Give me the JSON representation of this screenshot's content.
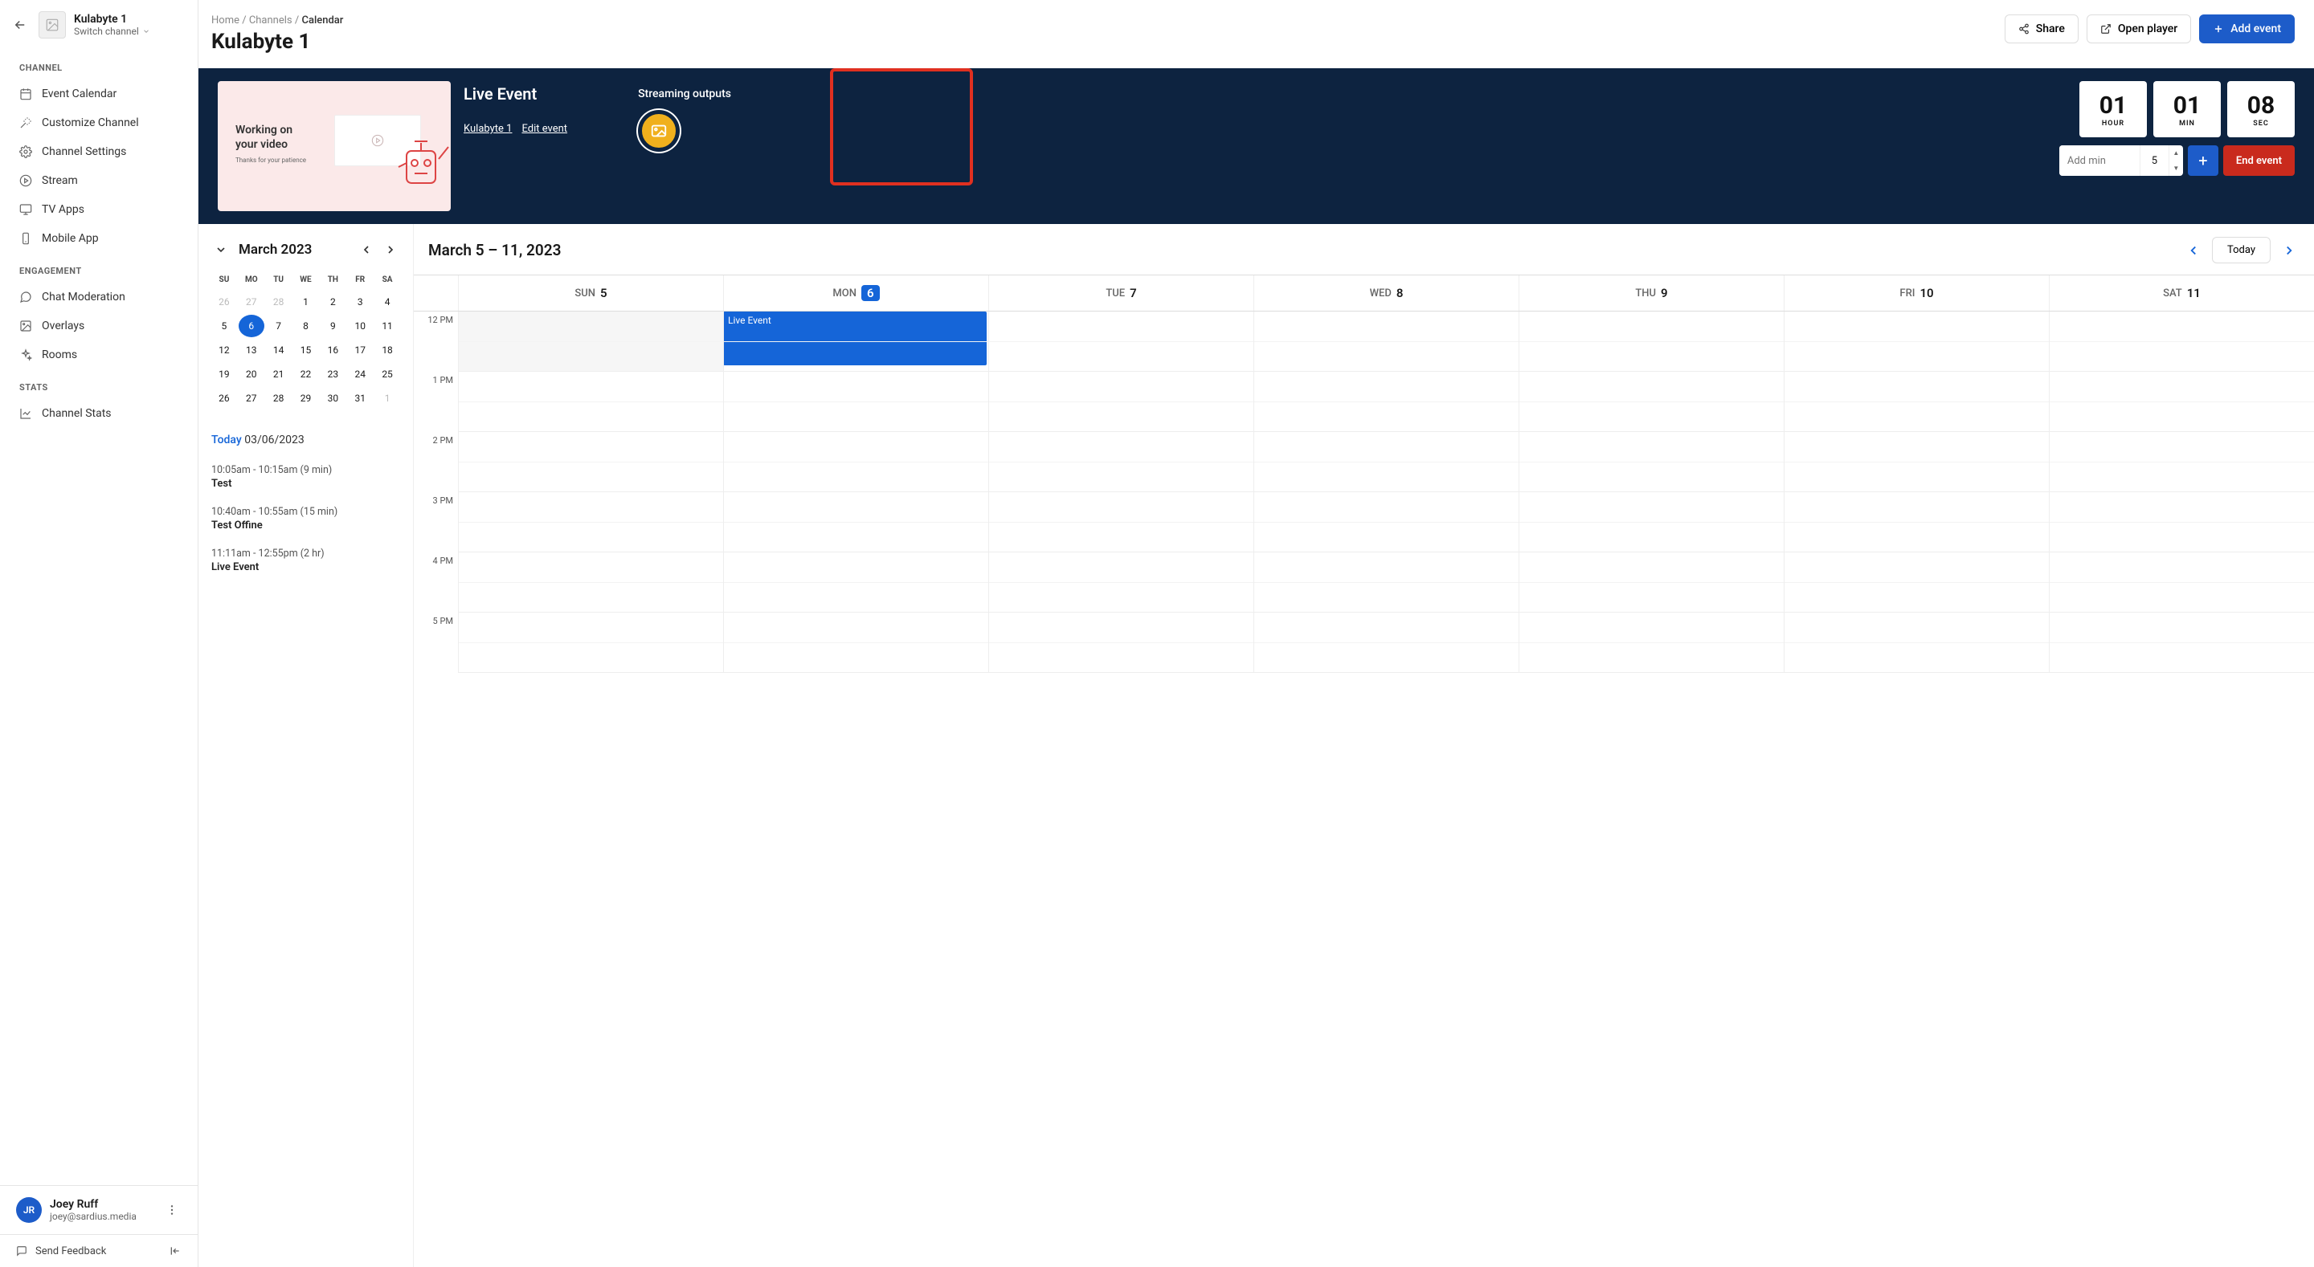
{
  "sidebar": {
    "channel_name": "Kulabyte 1",
    "switch_label": "Switch channel",
    "sections": {
      "channel": {
        "label": "CHANNEL",
        "items": [
          "Event Calendar",
          "Customize Channel",
          "Channel Settings",
          "Stream",
          "TV Apps",
          "Mobile App"
        ]
      },
      "engagement": {
        "label": "ENGAGEMENT",
        "items": [
          "Chat Moderation",
          "Overlays",
          "Rooms"
        ]
      },
      "stats": {
        "label": "STATS",
        "items": [
          "Channel Stats"
        ]
      }
    },
    "user": {
      "initials": "JR",
      "name": "Joey Ruff",
      "email": "joey@sardius.media"
    },
    "feedback": "Send Feedback"
  },
  "breadcrumb": {
    "home": "Home",
    "channels": "Channels",
    "current": "Calendar"
  },
  "page_title": "Kulabyte 1",
  "actions": {
    "share": "Share",
    "open_player": "Open player",
    "add_event": "Add event"
  },
  "live": {
    "title": "Live Event",
    "channel_link": "Kulabyte 1",
    "edit_link": "Edit event",
    "preview_title1": "Working on",
    "preview_title2": "your video",
    "preview_sub": "Thanks for your patience",
    "streaming": "Streaming outputs",
    "timer": {
      "hour": "01",
      "hour_l": "HOUR",
      "min": "01",
      "min_l": "MIN",
      "sec": "08",
      "sec_l": "SEC"
    },
    "add_min_placeholder": "Add min",
    "add_min_value": "5",
    "end_label": "End event"
  },
  "mini": {
    "title": "March 2023",
    "dow": [
      "SU",
      "MO",
      "TU",
      "WE",
      "TH",
      "FR",
      "SA"
    ],
    "days": [
      {
        "n": "26",
        "o": true
      },
      {
        "n": "27",
        "o": true
      },
      {
        "n": "28",
        "o": true
      },
      {
        "n": "1"
      },
      {
        "n": "2"
      },
      {
        "n": "3"
      },
      {
        "n": "4"
      },
      {
        "n": "5"
      },
      {
        "n": "6",
        "sel": true
      },
      {
        "n": "7"
      },
      {
        "n": "8"
      },
      {
        "n": "9"
      },
      {
        "n": "10"
      },
      {
        "n": "11"
      },
      {
        "n": "12"
      },
      {
        "n": "13"
      },
      {
        "n": "14"
      },
      {
        "n": "15"
      },
      {
        "n": "16"
      },
      {
        "n": "17"
      },
      {
        "n": "18"
      },
      {
        "n": "19"
      },
      {
        "n": "20"
      },
      {
        "n": "21"
      },
      {
        "n": "22"
      },
      {
        "n": "23"
      },
      {
        "n": "24"
      },
      {
        "n": "25"
      },
      {
        "n": "26"
      },
      {
        "n": "27"
      },
      {
        "n": "28"
      },
      {
        "n": "29"
      },
      {
        "n": "30"
      },
      {
        "n": "31"
      },
      {
        "n": "1",
        "o": true
      }
    ],
    "today_word": "Today",
    "today_date": "03/06/2023",
    "events": [
      {
        "time": "10:05am - 10:15am (9 min)",
        "name": "Test"
      },
      {
        "time": "10:40am - 10:55am (15 min)",
        "name": "Test Offine"
      },
      {
        "time": "11:11am - 12:55pm (2 hr)",
        "name": "Live Event"
      }
    ]
  },
  "week": {
    "title": "March 5 – 11, 2023",
    "today_btn": "Today",
    "days": [
      {
        "name": "SUN",
        "num": "5"
      },
      {
        "name": "MON",
        "num": "6",
        "sel": true
      },
      {
        "name": "TUE",
        "num": "7"
      },
      {
        "name": "WED",
        "num": "8"
      },
      {
        "name": "THU",
        "num": "9"
      },
      {
        "name": "FRI",
        "num": "10"
      },
      {
        "name": "SAT",
        "num": "11"
      }
    ],
    "hours": [
      "12 PM",
      "1 PM",
      "2 PM",
      "3 PM",
      "4 PM",
      "5 PM"
    ],
    "event_block": "Live Event"
  }
}
